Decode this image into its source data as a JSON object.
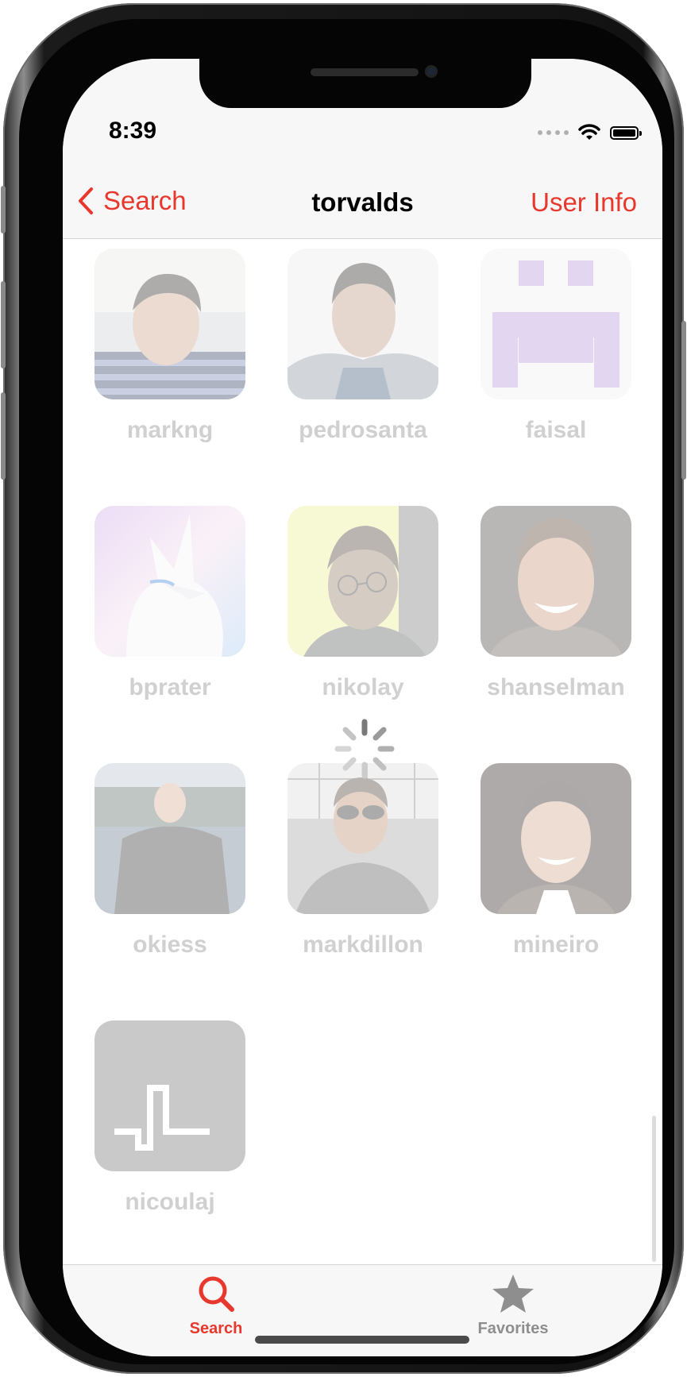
{
  "status_bar": {
    "time": "8:39"
  },
  "nav": {
    "back_label": "Search",
    "title": "torvalds",
    "right_label": "User Info"
  },
  "users": [
    {
      "name": "markng",
      "avatar": "photo-person-striped-shirt"
    },
    {
      "name": "pedrosanta",
      "avatar": "photo-person-white-background"
    },
    {
      "name": "faisal",
      "avatar": "identicon-purple"
    },
    {
      "name": "bprater",
      "avatar": "illustration-white-fox"
    },
    {
      "name": "nikolay",
      "avatar": "photo-person-glasses"
    },
    {
      "name": "shanselman",
      "avatar": "photo-person-smiling"
    },
    {
      "name": "okiess",
      "avatar": "photo-person-outdoors"
    },
    {
      "name": "markdillon",
      "avatar": "photo-person-sunglasses"
    },
    {
      "name": "mineiro",
      "avatar": "photo-person-dark-background"
    },
    {
      "name": "nicoulaj",
      "avatar": "logo-waveform"
    }
  ],
  "tabbar": {
    "search_label": "Search",
    "favorites_label": "Favorites",
    "active_color": "#e8382d",
    "inactive_color": "#8e8e8e"
  },
  "colors": {
    "accent": "#e8382d",
    "username_text": "#d0d0d0"
  }
}
